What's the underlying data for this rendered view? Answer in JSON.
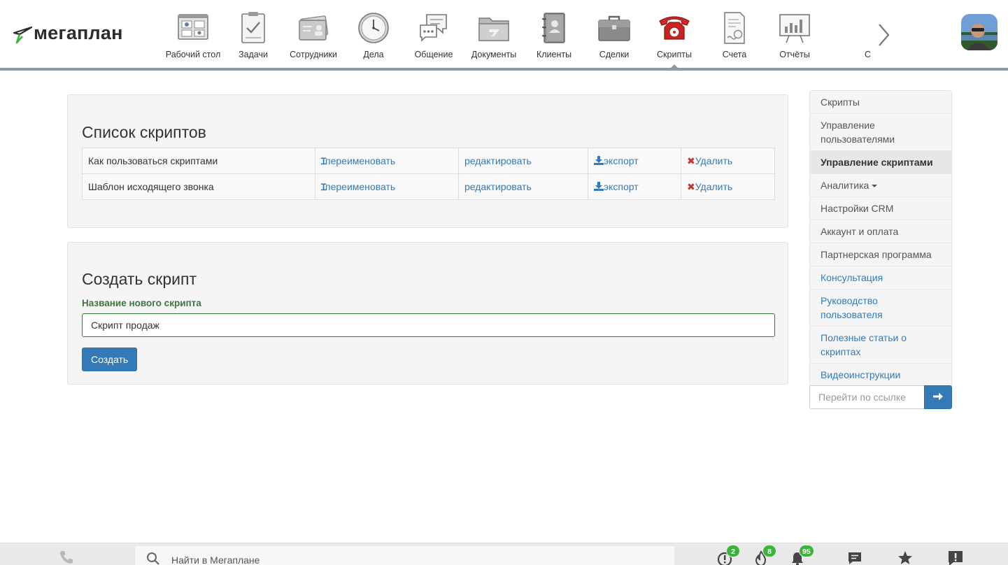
{
  "app": {
    "logo_text": "мегаплан"
  },
  "nav": {
    "items": [
      {
        "label": "Рабочий стол",
        "icon": "desktop-icon"
      },
      {
        "label": "Задачи",
        "icon": "tasks-icon"
      },
      {
        "label": "Сотрудники",
        "icon": "employees-icon"
      },
      {
        "label": "Дела",
        "icon": "clock-icon"
      },
      {
        "label": "Общение",
        "icon": "chat-icon"
      },
      {
        "label": "Документы",
        "icon": "folder-icon"
      },
      {
        "label": "Клиенты",
        "icon": "contacts-book-icon"
      },
      {
        "label": "Сделки",
        "icon": "briefcase-icon"
      },
      {
        "label": "Скрипты",
        "icon": "red-phone-icon",
        "active": true
      },
      {
        "label": "Счета",
        "icon": "invoice-icon"
      },
      {
        "label": "Отчёты",
        "icon": "report-board-icon"
      }
    ],
    "clipped_label": "С"
  },
  "scripts_list": {
    "title": "Список скриптов",
    "rows": [
      {
        "name": "Как пользоваться скриптами",
        "rename": "переименовать",
        "edit": "редактировать",
        "export": "экспорт",
        "delete": "Удалить"
      },
      {
        "name": "Шаблон исходящего звонка",
        "rename": "переименовать",
        "edit": "редактировать",
        "export": "экспорт",
        "delete": "Удалить"
      }
    ]
  },
  "create_script": {
    "title": "Создать скрипт",
    "field_label": "Название нового скрипта",
    "field_value": "Скрипт продаж",
    "button_label": "Создать"
  },
  "sidebar": {
    "items": [
      {
        "label": "Скрипты",
        "style": "plain"
      },
      {
        "label": "Управление пользователями",
        "style": "plain"
      },
      {
        "label": "Управление скриптами",
        "style": "active"
      },
      {
        "label": "Аналитика",
        "style": "dropdown"
      },
      {
        "label": "Настройки CRM",
        "style": "plain"
      },
      {
        "label": "Аккаунт и оплата",
        "style": "plain"
      },
      {
        "label": "Партнерская программа",
        "style": "plain"
      },
      {
        "label": "Консультация",
        "style": "link"
      },
      {
        "label": "Руководство пользователя",
        "style": "link"
      },
      {
        "label": "Полезные статьи о скриптах",
        "style": "link"
      },
      {
        "label": "Видеоинструкции",
        "style": "link"
      }
    ],
    "goto_placeholder": "Перейти по ссылке"
  },
  "bottom_bar": {
    "search_placeholder": "Найти в Мегаплане",
    "badges": {
      "alerts": "2",
      "hot": "8",
      "notifications": "95"
    }
  },
  "colors": {
    "accent": "#337ab7",
    "success": "#3c763d",
    "badge": "#3cb43c",
    "danger": "#c0392b"
  }
}
